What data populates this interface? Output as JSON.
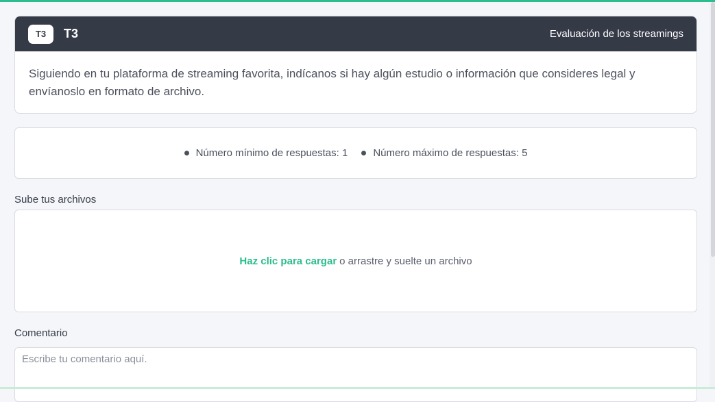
{
  "task": {
    "badge": "T3",
    "code": "T3",
    "category": "Evaluación de los streamings",
    "description": "Siguiendo en tu plataforma de streaming favorita, indícanos si hay algún estudio o información que consideres legal y envíanoslo en formato de archivo."
  },
  "limits": {
    "min": "Número mínimo de respuestas: 1",
    "max": "Número máximo de respuestas: 5"
  },
  "upload": {
    "label": "Sube tus archivos",
    "link": "Haz clic para cargar",
    "rest": "o arrastre y suelte un archivo"
  },
  "comment": {
    "label": "Comentario",
    "placeholder": "Escribe tu comentario aquí."
  },
  "colors": {
    "accent": "#2bbd8e",
    "header_bg": "#353a47",
    "page_bg": "#f5f6fa"
  }
}
